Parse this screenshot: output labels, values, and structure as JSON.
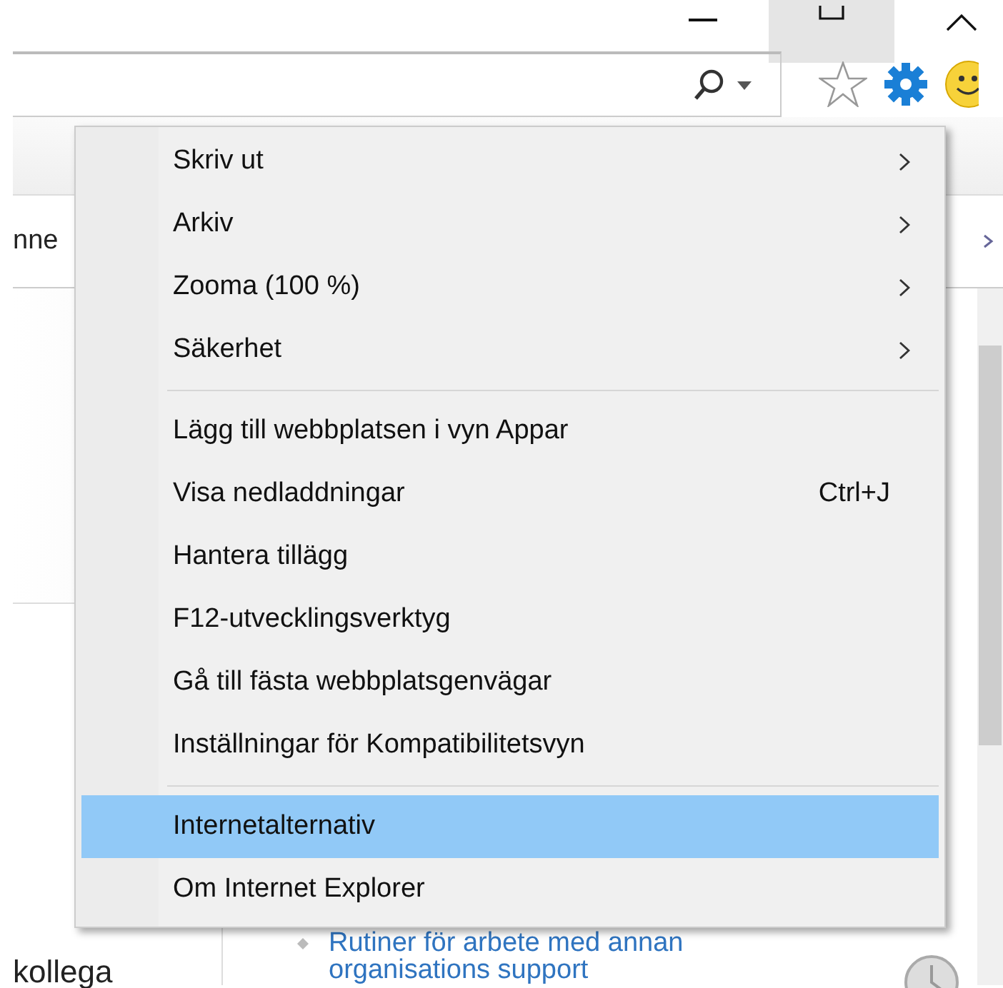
{
  "page": {
    "tab_fragment": "nne",
    "text_fragment": "kollega",
    "link_lines": [
      "Rutiner för arbete med annan",
      "organisations support"
    ]
  },
  "menu": {
    "groups": [
      [
        {
          "label": "Skriv ut",
          "submenu": true,
          "selected": false
        },
        {
          "label": "Arkiv",
          "submenu": true,
          "selected": false
        },
        {
          "label": "Zooma (100 %)",
          "submenu": true,
          "selected": false
        },
        {
          "label": "Säkerhet",
          "submenu": true,
          "selected": false
        }
      ],
      [
        {
          "label": "Lägg till webbplatsen i vyn Appar",
          "submenu": false,
          "selected": false
        },
        {
          "label": "Visa nedladdningar",
          "shortcut": "Ctrl+J",
          "submenu": false,
          "selected": false
        },
        {
          "label": "Hantera tillägg",
          "submenu": false,
          "selected": false
        },
        {
          "label": "F12-utvecklingsverktyg",
          "submenu": false,
          "selected": false
        },
        {
          "label": "Gå till fästa webbplatsgenvägar",
          "submenu": false,
          "selected": false
        },
        {
          "label": "Inställningar för Kompatibilitetsvyn",
          "submenu": false,
          "selected": false
        }
      ],
      [
        {
          "label": "Internetalternativ",
          "submenu": false,
          "selected": true
        },
        {
          "label": "Om Internet Explorer",
          "submenu": false,
          "selected": false
        }
      ]
    ]
  }
}
